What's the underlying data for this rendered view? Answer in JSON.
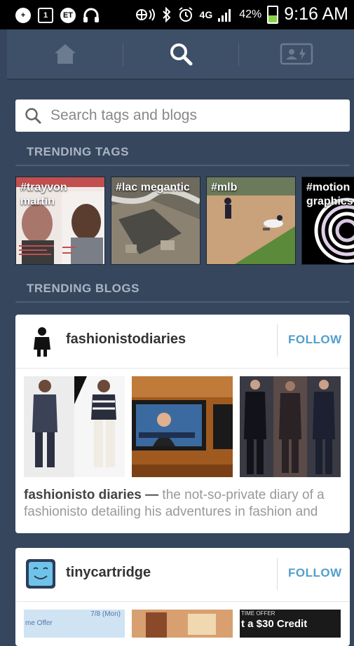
{
  "status_bar": {
    "battery": "42%",
    "network": "4G",
    "time": "9:16 AM",
    "left_icons": [
      "+",
      "1",
      "ET"
    ]
  },
  "nav": {
    "items": [
      {
        "icon": "home-icon",
        "active": false
      },
      {
        "icon": "search-icon",
        "active": true
      },
      {
        "icon": "activity-icon",
        "active": false
      }
    ]
  },
  "search": {
    "placeholder": "Search tags and blogs",
    "value": ""
  },
  "trending_tags": {
    "heading": "TRENDING TAGS",
    "items": [
      {
        "label": "#trayvon martin"
      },
      {
        "label": "#lac megantic"
      },
      {
        "label": "#mlb"
      },
      {
        "label": "#motion graphics"
      }
    ]
  },
  "trending_blogs": {
    "heading": "TRENDING BLOGS",
    "items": [
      {
        "name": "fashionistodiaries",
        "follow_label": "FOLLOW",
        "title": "fashionisto diaries —",
        "description": " the not-so-private diary of a fashionisto detailing his adventures in fashion and"
      },
      {
        "name": "tinycartridge",
        "follow_label": "FOLLOW",
        "thumb_texts": [
          "7/8 (Mon)",
          "me Offer",
          "TIME OFFER",
          "t a $30 Credit"
        ]
      }
    ]
  },
  "colors": {
    "background": "#36465d",
    "follow": "#529ecc",
    "status_bar": "#000000"
  }
}
